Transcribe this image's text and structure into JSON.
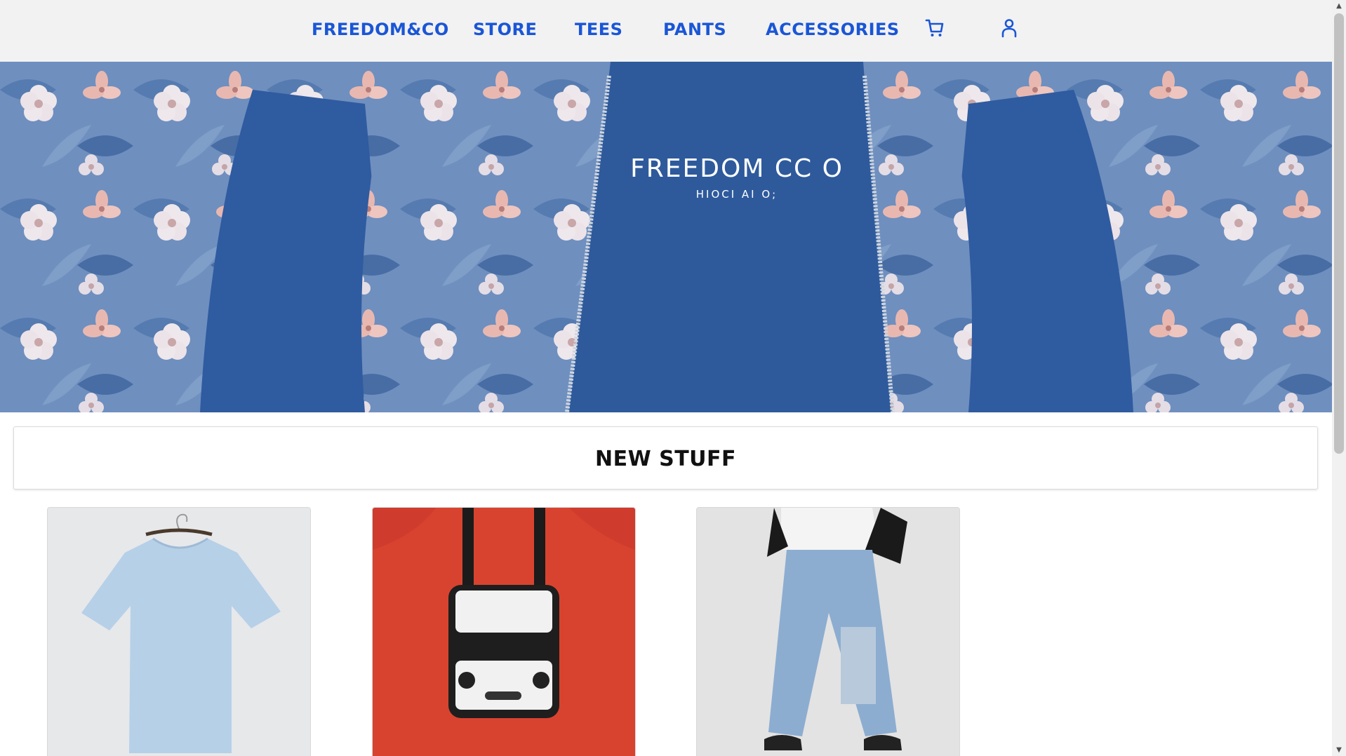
{
  "nav": {
    "brand": "FREEDOM&CO",
    "items": [
      {
        "label": "STORE"
      },
      {
        "label": "TEES"
      },
      {
        "label": "PANTS"
      },
      {
        "label": "ACCESSORIES"
      }
    ],
    "cart_icon": "cart-icon",
    "user_icon": "user-icon",
    "color": "#1a56d6"
  },
  "hero": {
    "brand_text": "FREEDOM CC O",
    "sub_text": "HIOCI AI O;",
    "colors": {
      "jacket": "#2e5a9c",
      "floral_bg": "#6f8fbf",
      "flower_pink": "#e8b8b0",
      "flower_white": "#eee8ec"
    }
  },
  "section": {
    "title": "NEW STUFF"
  },
  "products": [
    {
      "name": "light-blue-tee",
      "image_icon": "tshirt-image"
    },
    {
      "name": "crossbody-bag",
      "image_icon": "bag-image"
    },
    {
      "name": "baggy-jeans",
      "image_icon": "jeans-image"
    }
  ],
  "scrollbar": {
    "up_arrow": "▲",
    "down_arrow": "▼"
  }
}
